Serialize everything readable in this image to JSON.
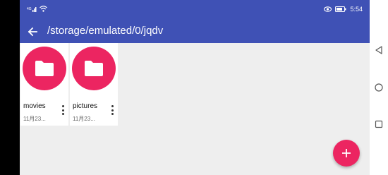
{
  "status_bar": {
    "left_icons": [
      "signal-icon",
      "wifi-icon"
    ],
    "right_icons": [
      "eye-icon",
      "battery-icon"
    ],
    "time": "5:54"
  },
  "toolbar": {
    "path": "/storage/emulated/0/jqdv"
  },
  "folders": [
    {
      "name": "movies",
      "date": "11月23..."
    },
    {
      "name": "pictures",
      "date": "11月23..."
    }
  ],
  "fab": {
    "icon": "plus-icon"
  },
  "nav": {
    "buttons": [
      "back-icon",
      "home-icon",
      "recents-icon"
    ]
  },
  "colors": {
    "primary": "#3f51b5",
    "accent": "#ec2561",
    "background": "#eeeeee"
  }
}
